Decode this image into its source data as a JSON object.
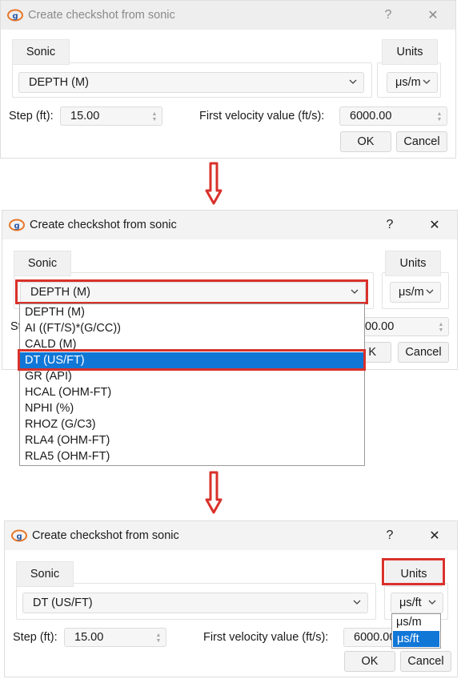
{
  "dialog": {
    "title": "Create checkshot from sonic",
    "help_label": "?",
    "close_label": "✕",
    "sonic_tab": "Sonic",
    "units_tab": "Units",
    "step_label": "Step (ft):",
    "step_value": "15.00",
    "velocity_label": "First velocity value (ft/s):",
    "velocity_value": "6000.00",
    "ok_label": "OK",
    "cancel_label": "Cancel"
  },
  "step1": {
    "sonic_selected": "DEPTH (M)",
    "units_selected": "μs/m"
  },
  "step2": {
    "sonic_selected": "DEPTH (M)",
    "units_selected": "μs/m",
    "step_label_partial": "St",
    "velocity_value_partial": "00.00",
    "ok_partial": "K",
    "sonic_options": [
      "DEPTH (M)",
      "AI ((FT/S)*(G/CC))",
      "CALD (M)",
      "DT (US/FT)",
      "GR (API)",
      "HCAL (OHM-FT)",
      "NPHI (%)",
      "RHOZ (G/C3)",
      "RLA4 (OHM-FT)",
      "RLA5 (OHM-FT)"
    ],
    "highlighted_option": "DT (US/FT)"
  },
  "step3": {
    "sonic_selected": "DT (US/FT)",
    "units_selected": "μs/ft",
    "velocity_value_partial": "6000.00",
    "units_options": [
      "μs/m",
      "μs/ft"
    ],
    "highlighted_unit": "μs/ft"
  },
  "colors": {
    "annotation_red": "#d9312b",
    "selection_blue": "#1077d7"
  }
}
